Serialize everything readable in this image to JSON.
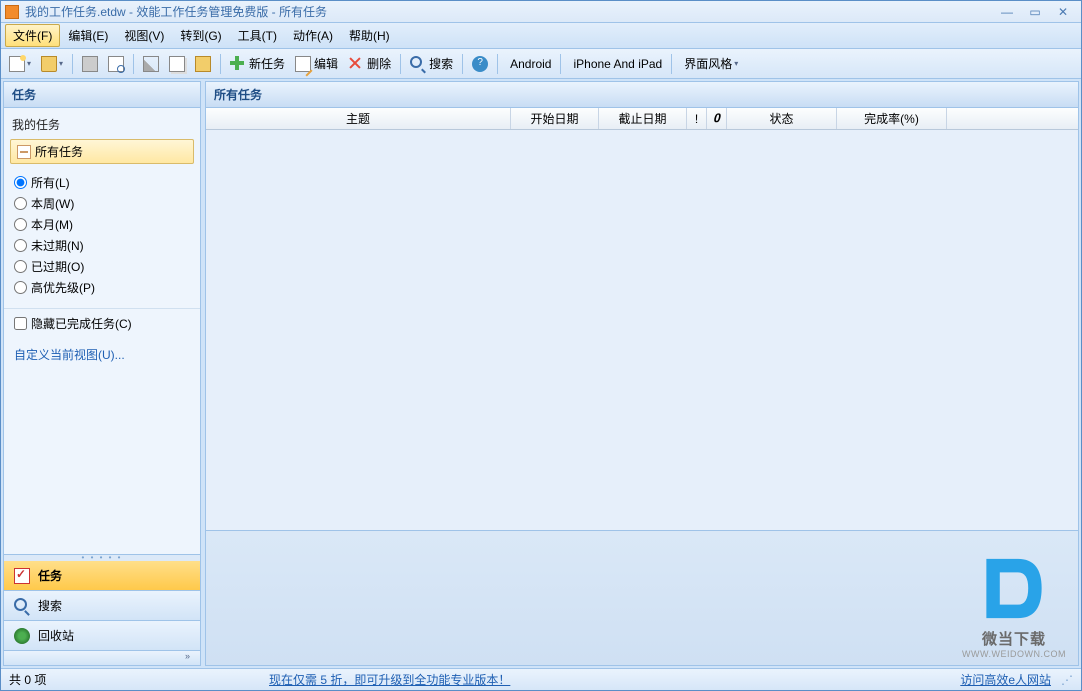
{
  "title": "我的工作任务.etdw - 效能工作任务管理免费版 - 所有任务",
  "menu": {
    "file": "文件(F)",
    "edit": "编辑(E)",
    "view": "视图(V)",
    "goto": "转到(G)",
    "tools": "工具(T)",
    "action": "动作(A)",
    "help": "帮助(H)"
  },
  "toolbar": {
    "new_task": "新任务",
    "edit": "编辑",
    "delete": "删除",
    "search": "搜索",
    "android": "Android",
    "iphone": "iPhone And iPad",
    "theme": "界面风格"
  },
  "sidebar": {
    "header": "任务",
    "my_tasks": "我的任务",
    "all_tasks": "所有任务",
    "filters": {
      "all": "所有(L)",
      "this_week": "本周(W)",
      "this_month": "本月(M)",
      "not_overdue": "未过期(N)",
      "overdue": "已过期(O)",
      "high_priority": "高优先级(P)"
    },
    "hide_completed": "隐藏已完成任务(C)",
    "custom_view": "自定义当前视图(U)..."
  },
  "nav": {
    "tasks": "任务",
    "search": "搜索",
    "recycle": "回收站"
  },
  "content": {
    "header": "所有任务",
    "columns": {
      "subject": "主题",
      "start_date": "开始日期",
      "due_date": "截止日期",
      "priority": "!",
      "attachment": "📎",
      "status": "状态",
      "completion": "完成率(%)"
    }
  },
  "watermark": {
    "text": "微当下载",
    "url": "WWW.WEIDOWN.COM"
  },
  "statusbar": {
    "count": "共 0 项",
    "promo": "现在仅需 5 折，即可升级到全功能专业版本！",
    "website": "访问高效e人网站"
  }
}
